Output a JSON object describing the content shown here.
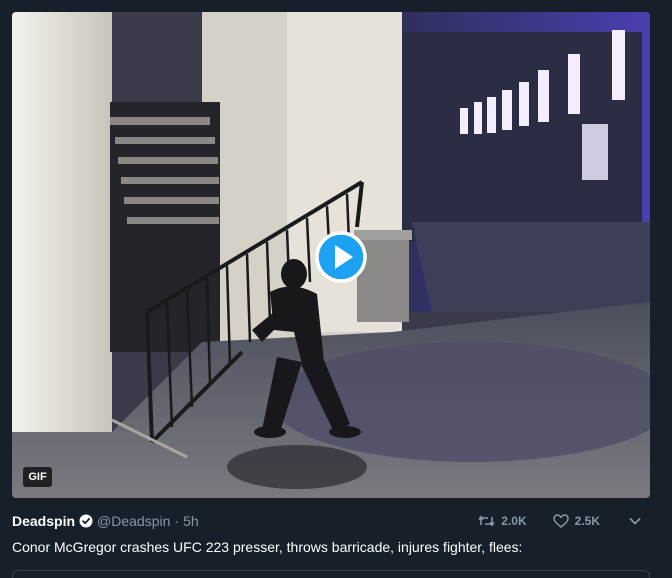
{
  "media": {
    "badge": "GIF",
    "icon": "play-icon"
  },
  "tweet": {
    "author_name": "Deadspin",
    "handle": "@Deadspin",
    "separator": "·",
    "time": "5h",
    "retweets": "2.0K",
    "likes": "2.5K",
    "text": "Conor McGregor crashes UFC 223 presser, throws barricade, injures fighter, flees:"
  },
  "colors": {
    "background": "#15202b",
    "accent": "#1da1f2",
    "muted": "#8899a6"
  }
}
